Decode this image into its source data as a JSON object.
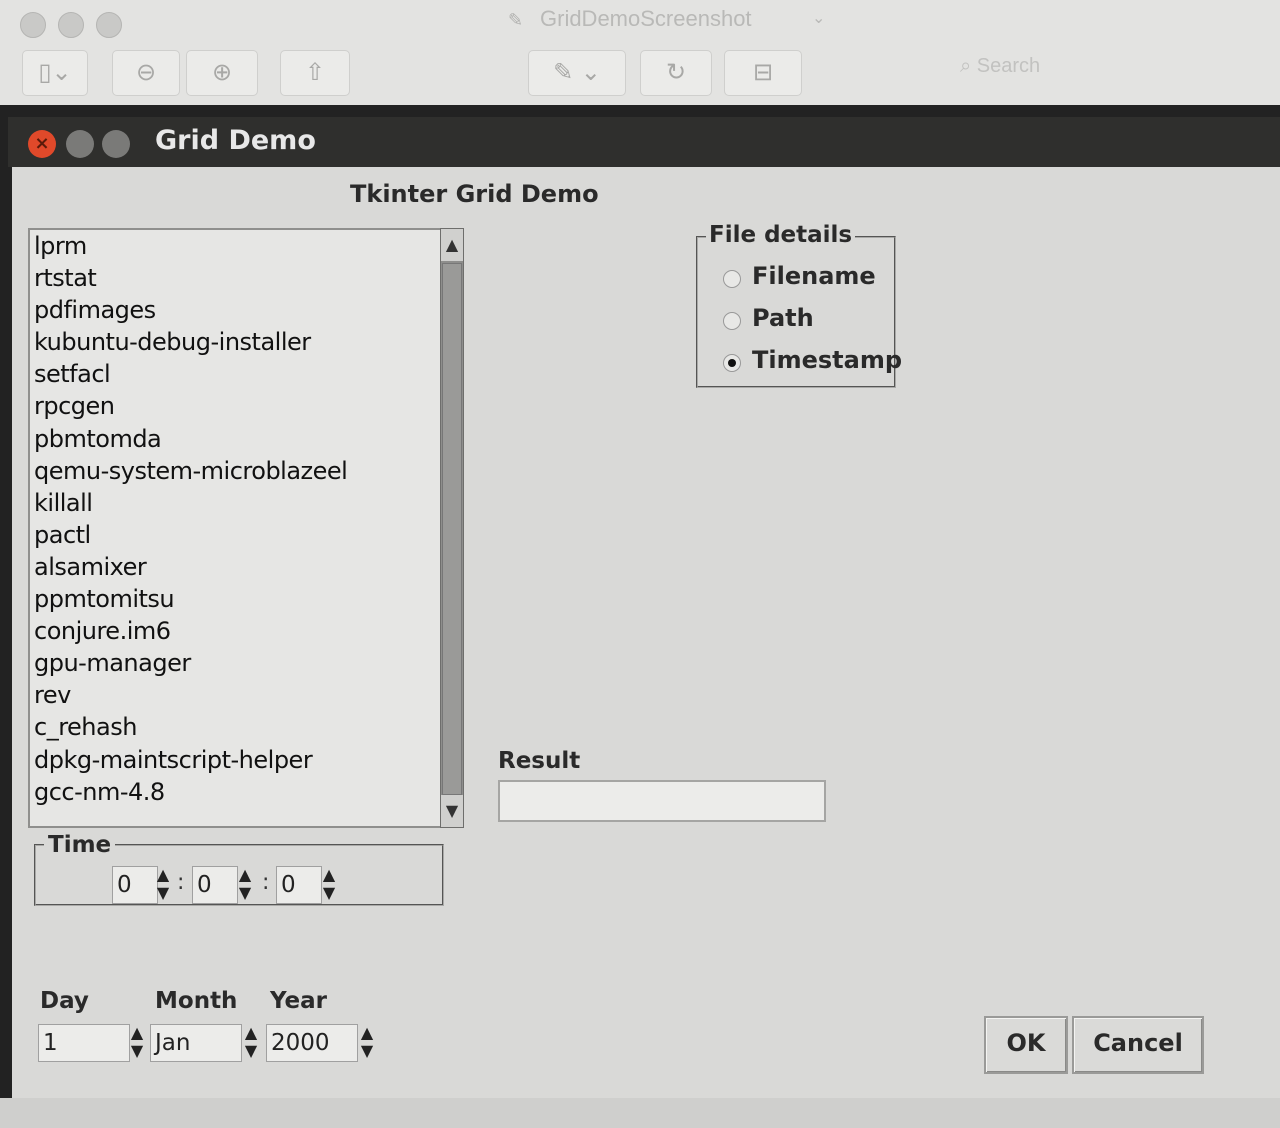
{
  "viewer": {
    "title": "GridDemoScreenshot",
    "search_placeholder": "Search"
  },
  "window": {
    "title": "Grid Demo"
  },
  "heading": "Tkinter Grid Demo",
  "listbox": {
    "items": [
      "lprm",
      "rtstat",
      "pdfimages",
      "kubuntu-debug-installer",
      "setfacl",
      "rpcgen",
      "pbmtomda",
      "qemu-system-microblazeel",
      "killall",
      "pactl",
      "alsamixer",
      "ppmtomitsu",
      "conjure.im6",
      "gpu-manager",
      "rev",
      "c_rehash",
      "dpkg-maintscript-helper",
      "gcc-nm-4.8"
    ]
  },
  "file_details": {
    "legend": "File details",
    "options": [
      {
        "label": "Filename",
        "selected": false
      },
      {
        "label": "Path",
        "selected": false
      },
      {
        "label": "Timestamp",
        "selected": true
      }
    ]
  },
  "result": {
    "label": "Result",
    "value": ""
  },
  "time": {
    "legend": "Time",
    "hours": "0",
    "minutes": "0",
    "seconds": "0",
    "separator": ":"
  },
  "date": {
    "day_label": "Day",
    "month_label": "Month",
    "year_label": "Year",
    "day": "1",
    "month": "Jan",
    "year": "2000"
  },
  "buttons": {
    "ok": "OK",
    "cancel": "Cancel"
  }
}
